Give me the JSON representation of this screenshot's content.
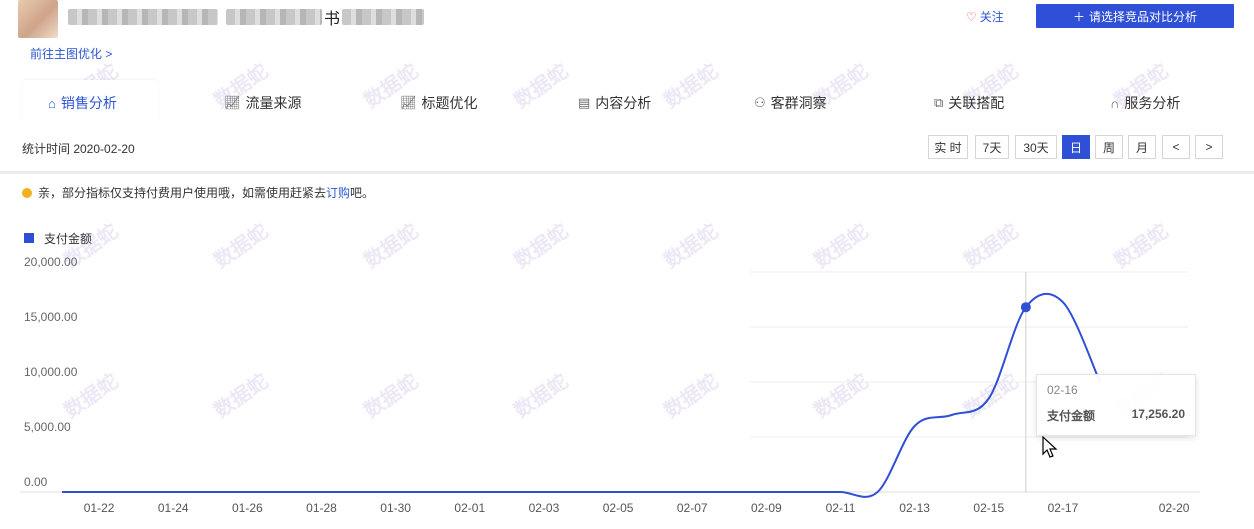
{
  "header": {
    "title_visible_char": "书",
    "goto_link": "前往主图优化 >",
    "follow_label": "关注",
    "compare_label": "请选择竞品对比分析"
  },
  "tabs": [
    {
      "label": "销售分析",
      "icon": "bag-icon",
      "active": true
    },
    {
      "label": "流量来源",
      "icon": "line-chart-icon"
    },
    {
      "label": "标题优化",
      "icon": "line-chart-icon"
    },
    {
      "label": "内容分析",
      "icon": "document-icon"
    },
    {
      "label": "客群洞察",
      "icon": "users-icon"
    },
    {
      "label": "关联搭配",
      "icon": "link-icon"
    },
    {
      "label": "服务分析",
      "icon": "headset-icon"
    }
  ],
  "stats": {
    "time_label": "统计时间 2020-02-20",
    "ranges": [
      "实 时",
      "7天",
      "30天",
      "日",
      "周",
      "月",
      "<",
      ">"
    ],
    "active_range": "日"
  },
  "notice": {
    "text_before": "亲，部分指标仅支持付费用户使用哦，如需使用赶紧去",
    "link": "订购",
    "text_after": "吧。"
  },
  "tooltip": {
    "date": "02-16",
    "label": "支付金额",
    "value": "17,256.20"
  },
  "watermark": "数据蛇",
  "chart_data": {
    "type": "line",
    "series": [
      {
        "name": "支付金额",
        "values": [
          0,
          0,
          0,
          0,
          0,
          0,
          0,
          0,
          0,
          0,
          0,
          0,
          0,
          0,
          0,
          0,
          0,
          0,
          0,
          0,
          0,
          0,
          0,
          6000,
          7000,
          8500,
          16800,
          17256.2,
          10000
        ]
      }
    ],
    "x": [
      "01-21",
      "01-22",
      "01-23",
      "01-24",
      "01-25",
      "01-26",
      "01-27",
      "01-28",
      "01-29",
      "01-30",
      "01-31",
      "02-01",
      "02-02",
      "02-03",
      "02-04",
      "02-05",
      "02-06",
      "02-07",
      "02-08",
      "02-09",
      "02-10",
      "02-11",
      "02-12",
      "02-13",
      "02-14",
      "02-15",
      "02-16",
      "02-17",
      "02-18"
    ],
    "x_ticks": [
      "01-22",
      "01-24",
      "01-26",
      "01-28",
      "01-30",
      "02-01",
      "02-03",
      "02-05",
      "02-07",
      "02-09",
      "02-11",
      "02-13",
      "02-15",
      "02-17",
      "02-20"
    ],
    "y_ticks": [
      "20,000.00",
      "15,000.00",
      "10,000.00",
      "5,000.00",
      "0.00"
    ],
    "ylim": [
      0,
      20000
    ],
    "legend_position": "top-left",
    "color": "#2e4fd6"
  }
}
